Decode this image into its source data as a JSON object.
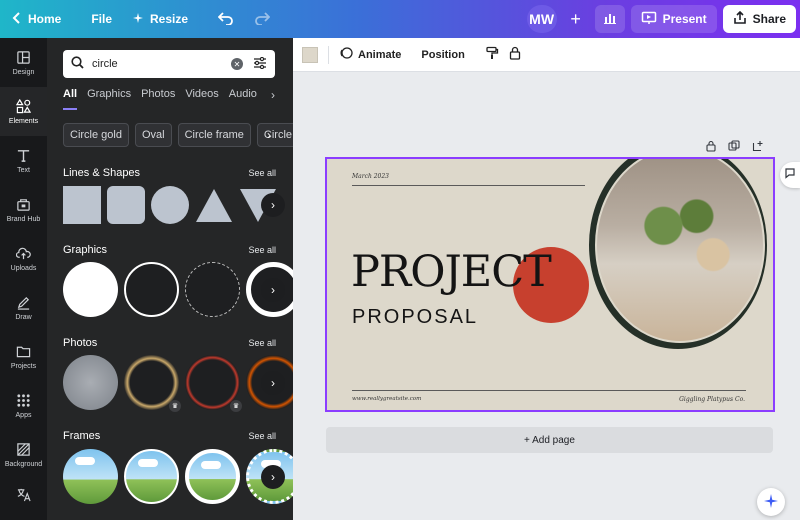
{
  "topbar": {
    "home_label": "Home",
    "file_label": "File",
    "resize_label": "Resize",
    "avatar_initials": "MW",
    "plus_label": "+",
    "present_label": "Present",
    "share_label": "Share"
  },
  "rail": {
    "items": [
      {
        "label": "Design",
        "icon": "design-icon"
      },
      {
        "label": "Elements",
        "icon": "elements-icon",
        "active": true
      },
      {
        "label": "Text",
        "icon": "text-icon"
      },
      {
        "label": "Brand Hub",
        "icon": "brand-hub-icon"
      },
      {
        "label": "Uploads",
        "icon": "uploads-icon"
      },
      {
        "label": "Draw",
        "icon": "draw-icon"
      },
      {
        "label": "Projects",
        "icon": "projects-icon"
      },
      {
        "label": "Apps",
        "icon": "apps-icon"
      },
      {
        "label": "Background",
        "icon": "background-icon"
      }
    ]
  },
  "panel": {
    "search_value": "circle",
    "tabs": [
      "All",
      "Graphics",
      "Photos",
      "Videos",
      "Audio"
    ],
    "chips": [
      "Circle gold",
      "Oval",
      "Circle frame",
      "Circle"
    ],
    "sections": {
      "lines": {
        "title": "Lines & Shapes",
        "see_all": "See all"
      },
      "graphics": {
        "title": "Graphics",
        "see_all": "See all"
      },
      "photos": {
        "title": "Photos",
        "see_all": "See all"
      },
      "frames": {
        "title": "Frames",
        "see_all": "See all"
      }
    }
  },
  "toolbar": {
    "animate_label": "Animate",
    "position_label": "Position",
    "color_swatch": "#ddd7ca"
  },
  "slide": {
    "date": "March 2023",
    "title_main": "PROJECT",
    "title_sub": "PROPOSAL",
    "footer_left": "www.reallygreatsite.com",
    "footer_right": "Giggling Platypus Co.",
    "accent_red": "#c7402e",
    "bg": "#ddd8cb"
  },
  "canvas": {
    "add_page_label": "+ Add page"
  },
  "colors": {
    "selection": "#8b3dff",
    "panel_bg": "#252627",
    "rail_bg": "#18191b"
  }
}
